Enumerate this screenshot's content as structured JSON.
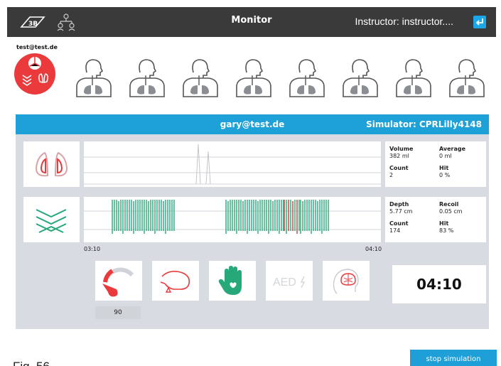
{
  "header": {
    "title": "Monitor",
    "instructor": "Instructor: instructor...."
  },
  "active_user": {
    "email": "test@test.de"
  },
  "simulators": [
    {},
    {},
    {},
    {},
    {},
    {},
    {},
    {}
  ],
  "panel": {
    "email": "gary@test.de",
    "simulator": "Simulator: CPRLilly4148",
    "ventilation": {
      "volume_label": "Volume",
      "volume_value": "382 ml",
      "average_label": "Average",
      "average_value": "0 ml",
      "count_label": "Count",
      "count_value": "2",
      "hit_label": "Hit",
      "hit_value": "0 %"
    },
    "compression": {
      "depth_label": "Depth",
      "depth_value": "5.77 cm",
      "recoil_label": "Recoil",
      "recoil_value": "0.05 cm",
      "count_label": "Count",
      "count_value": "174",
      "hit_label": "Hit",
      "hit_value": "83 %"
    },
    "time_start": "03:10",
    "time_end": "04:10",
    "heart_rate": "90",
    "aed_label": "AED",
    "timer": "04:10"
  },
  "footer": {
    "figure": "Fig. 56",
    "stop_label": "stop simulation"
  },
  "colors": {
    "accent": "#1ea0d8",
    "alert": "#ea3a3c",
    "good": "#27a878",
    "bad": "#c93a3a"
  }
}
